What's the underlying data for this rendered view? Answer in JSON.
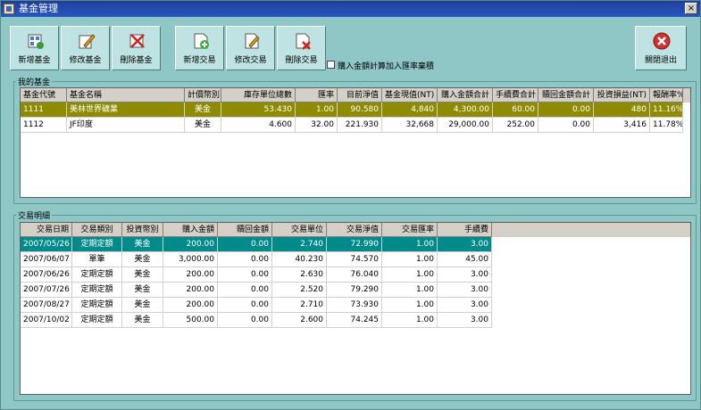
{
  "window": {
    "title": "基金管理",
    "close": "×"
  },
  "toolbar": {
    "add_fund": "新增基金",
    "edit_fund": "修改基金",
    "delete_fund": "刪除基金",
    "add_trade": "新增交易",
    "edit_trade": "修改交易",
    "delete_trade": "刪除交易",
    "checkbox_label": "購入金額計算加入匯率棄積",
    "exit": "關閉退出"
  },
  "funds": {
    "group_label": "我的基金",
    "columns": [
      "基金代號",
      "基金名稱",
      "計價幣別",
      "庫存單位總數",
      "匯率",
      "目前淨值",
      "基金現值(NT)",
      "購入金額合計",
      "手續費合計",
      "贖回金額合計",
      "投資損益(NT)",
      "報酬率%"
    ],
    "rows": [
      [
        "1111",
        "美林世界礦業",
        "美金",
        "53.430",
        "1.00",
        "90.580",
        "4,840",
        "4,300.00",
        "60.00",
        "0.00",
        "480",
        "11.16%"
      ],
      [
        "1112",
        "JF印度",
        "美金",
        "4.600",
        "32.00",
        "221.930",
        "32,668",
        "29,000.00",
        "252.00",
        "0.00",
        "3,416",
        "11.78%"
      ]
    ]
  },
  "trades": {
    "group_label": "交易明細",
    "columns": [
      "交易日期",
      "交易類別",
      "投資幣別",
      "購入金額",
      "贖回金額",
      "交易單位",
      "交易淨值",
      "交易匯率",
      "手續費"
    ],
    "rows": [
      [
        "2007/05/26",
        "定期定額",
        "美金",
        "200.00",
        "0.00",
        "2.740",
        "72.990",
        "1.00",
        "3.00"
      ],
      [
        "2007/06/07",
        "單筆",
        "美金",
        "3,000.00",
        "0.00",
        "40.230",
        "74.570",
        "1.00",
        "45.00"
      ],
      [
        "2007/06/26",
        "定期定額",
        "美金",
        "200.00",
        "0.00",
        "2.630",
        "76.040",
        "1.00",
        "3.00"
      ],
      [
        "2007/07/26",
        "定期定額",
        "美金",
        "200.00",
        "0.00",
        "2.520",
        "79.290",
        "1.00",
        "3.00"
      ],
      [
        "2007/08/27",
        "定期定額",
        "美金",
        "200.00",
        "0.00",
        "2.710",
        "73.930",
        "1.00",
        "3.00"
      ],
      [
        "2007/10/02",
        "定期定額",
        "美金",
        "500.00",
        "0.00",
        "2.600",
        "74.245",
        "1.00",
        "3.00"
      ]
    ]
  },
  "colors": {
    "window_bg": "#8fc7c7",
    "selected_fund": "#8e8b00",
    "selected_trade": "#008a8a"
  }
}
